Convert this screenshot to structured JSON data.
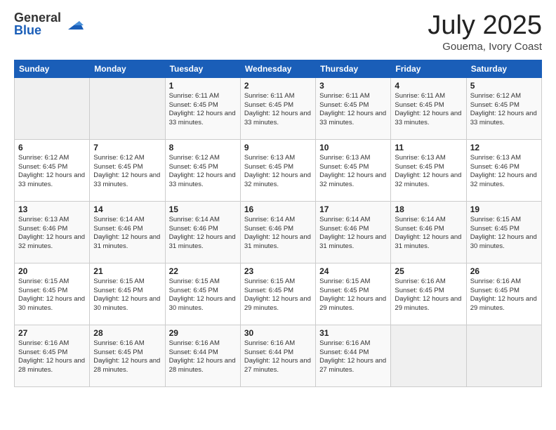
{
  "logo": {
    "general": "General",
    "blue": "Blue"
  },
  "title": "July 2025",
  "location": "Gouema, Ivory Coast",
  "days_of_week": [
    "Sunday",
    "Monday",
    "Tuesday",
    "Wednesday",
    "Thursday",
    "Friday",
    "Saturday"
  ],
  "weeks": [
    [
      {
        "day": "",
        "info": ""
      },
      {
        "day": "",
        "info": ""
      },
      {
        "day": "1",
        "info": "Sunrise: 6:11 AM\nSunset: 6:45 PM\nDaylight: 12 hours and 33 minutes."
      },
      {
        "day": "2",
        "info": "Sunrise: 6:11 AM\nSunset: 6:45 PM\nDaylight: 12 hours and 33 minutes."
      },
      {
        "day": "3",
        "info": "Sunrise: 6:11 AM\nSunset: 6:45 PM\nDaylight: 12 hours and 33 minutes."
      },
      {
        "day": "4",
        "info": "Sunrise: 6:11 AM\nSunset: 6:45 PM\nDaylight: 12 hours and 33 minutes."
      },
      {
        "day": "5",
        "info": "Sunrise: 6:12 AM\nSunset: 6:45 PM\nDaylight: 12 hours and 33 minutes."
      }
    ],
    [
      {
        "day": "6",
        "info": "Sunrise: 6:12 AM\nSunset: 6:45 PM\nDaylight: 12 hours and 33 minutes."
      },
      {
        "day": "7",
        "info": "Sunrise: 6:12 AM\nSunset: 6:45 PM\nDaylight: 12 hours and 33 minutes."
      },
      {
        "day": "8",
        "info": "Sunrise: 6:12 AM\nSunset: 6:45 PM\nDaylight: 12 hours and 33 minutes."
      },
      {
        "day": "9",
        "info": "Sunrise: 6:13 AM\nSunset: 6:45 PM\nDaylight: 12 hours and 32 minutes."
      },
      {
        "day": "10",
        "info": "Sunrise: 6:13 AM\nSunset: 6:45 PM\nDaylight: 12 hours and 32 minutes."
      },
      {
        "day": "11",
        "info": "Sunrise: 6:13 AM\nSunset: 6:45 PM\nDaylight: 12 hours and 32 minutes."
      },
      {
        "day": "12",
        "info": "Sunrise: 6:13 AM\nSunset: 6:46 PM\nDaylight: 12 hours and 32 minutes."
      }
    ],
    [
      {
        "day": "13",
        "info": "Sunrise: 6:13 AM\nSunset: 6:46 PM\nDaylight: 12 hours and 32 minutes."
      },
      {
        "day": "14",
        "info": "Sunrise: 6:14 AM\nSunset: 6:46 PM\nDaylight: 12 hours and 31 minutes."
      },
      {
        "day": "15",
        "info": "Sunrise: 6:14 AM\nSunset: 6:46 PM\nDaylight: 12 hours and 31 minutes."
      },
      {
        "day": "16",
        "info": "Sunrise: 6:14 AM\nSunset: 6:46 PM\nDaylight: 12 hours and 31 minutes."
      },
      {
        "day": "17",
        "info": "Sunrise: 6:14 AM\nSunset: 6:46 PM\nDaylight: 12 hours and 31 minutes."
      },
      {
        "day": "18",
        "info": "Sunrise: 6:14 AM\nSunset: 6:46 PM\nDaylight: 12 hours and 31 minutes."
      },
      {
        "day": "19",
        "info": "Sunrise: 6:15 AM\nSunset: 6:45 PM\nDaylight: 12 hours and 30 minutes."
      }
    ],
    [
      {
        "day": "20",
        "info": "Sunrise: 6:15 AM\nSunset: 6:45 PM\nDaylight: 12 hours and 30 minutes."
      },
      {
        "day": "21",
        "info": "Sunrise: 6:15 AM\nSunset: 6:45 PM\nDaylight: 12 hours and 30 minutes."
      },
      {
        "day": "22",
        "info": "Sunrise: 6:15 AM\nSunset: 6:45 PM\nDaylight: 12 hours and 30 minutes."
      },
      {
        "day": "23",
        "info": "Sunrise: 6:15 AM\nSunset: 6:45 PM\nDaylight: 12 hours and 29 minutes."
      },
      {
        "day": "24",
        "info": "Sunrise: 6:15 AM\nSunset: 6:45 PM\nDaylight: 12 hours and 29 minutes."
      },
      {
        "day": "25",
        "info": "Sunrise: 6:16 AM\nSunset: 6:45 PM\nDaylight: 12 hours and 29 minutes."
      },
      {
        "day": "26",
        "info": "Sunrise: 6:16 AM\nSunset: 6:45 PM\nDaylight: 12 hours and 29 minutes."
      }
    ],
    [
      {
        "day": "27",
        "info": "Sunrise: 6:16 AM\nSunset: 6:45 PM\nDaylight: 12 hours and 28 minutes."
      },
      {
        "day": "28",
        "info": "Sunrise: 6:16 AM\nSunset: 6:45 PM\nDaylight: 12 hours and 28 minutes."
      },
      {
        "day": "29",
        "info": "Sunrise: 6:16 AM\nSunset: 6:44 PM\nDaylight: 12 hours and 28 minutes."
      },
      {
        "day": "30",
        "info": "Sunrise: 6:16 AM\nSunset: 6:44 PM\nDaylight: 12 hours and 27 minutes."
      },
      {
        "day": "31",
        "info": "Sunrise: 6:16 AM\nSunset: 6:44 PM\nDaylight: 12 hours and 27 minutes."
      },
      {
        "day": "",
        "info": ""
      },
      {
        "day": "",
        "info": ""
      }
    ]
  ]
}
